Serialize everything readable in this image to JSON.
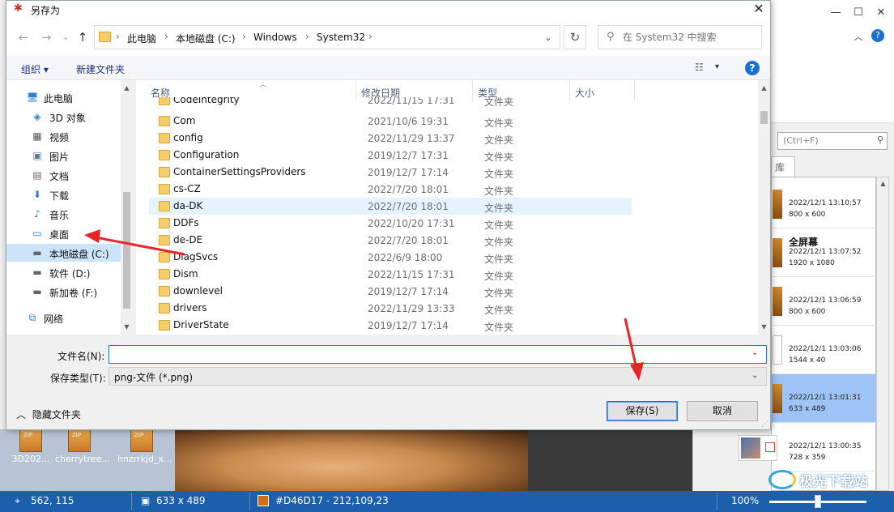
{
  "dialog": {
    "title": "另存为",
    "close_label": "✕"
  },
  "nav": {
    "back": "←",
    "forward": "→",
    "recent": "⌄",
    "up": "↑",
    "breadcrumbs": [
      "此电脑",
      "本地磁盘 (C:)",
      "Windows",
      "System32"
    ],
    "refresh": "↻",
    "search_placeholder": "在 System32 中搜索"
  },
  "toolbar": {
    "organize": "组织 ▾",
    "new_folder": "新建文件夹",
    "view": "☷",
    "view_dd": "▾",
    "help": "?"
  },
  "tree": [
    {
      "label": "此电脑",
      "icon": "pc-icon",
      "glyph": "🖥"
    },
    {
      "label": "3D 对象",
      "icon": "cube-icon",
      "glyph": "◈"
    },
    {
      "label": "视频",
      "icon": "video-icon",
      "glyph": "▦"
    },
    {
      "label": "图片",
      "icon": "image-icon",
      "glyph": "▣"
    },
    {
      "label": "文档",
      "icon": "document-icon",
      "glyph": "▤"
    },
    {
      "label": "下载",
      "icon": "download-icon",
      "glyph": "⬇"
    },
    {
      "label": "音乐",
      "icon": "music-icon",
      "glyph": "♪"
    },
    {
      "label": "桌面",
      "icon": "desktop-icon",
      "glyph": "▭"
    },
    {
      "label": "本地磁盘 (C:)",
      "icon": "drive-c-icon",
      "glyph": "▬"
    },
    {
      "label": "软件 (D:)",
      "icon": "drive-d-icon",
      "glyph": "▬"
    },
    {
      "label": "新加卷 (F:)",
      "icon": "drive-f-icon",
      "glyph": "▬"
    },
    {
      "label": "网络",
      "icon": "network-icon",
      "glyph": "⧉"
    }
  ],
  "columns": [
    "名称",
    "修改日期",
    "类型",
    "大小"
  ],
  "files": [
    {
      "name": "CodeIntegrity",
      "date": "2022/11/15 17:31",
      "type": "文件夹"
    },
    {
      "name": "Com",
      "date": "2021/10/6 19:31",
      "type": "文件夹"
    },
    {
      "name": "config",
      "date": "2022/11/29 13:37",
      "type": "文件夹"
    },
    {
      "name": "Configuration",
      "date": "2019/12/7 17:31",
      "type": "文件夹"
    },
    {
      "name": "ContainerSettingsProviders",
      "date": "2019/12/7 17:14",
      "type": "文件夹"
    },
    {
      "name": "cs-CZ",
      "date": "2022/7/20 18:01",
      "type": "文件夹"
    },
    {
      "name": "da-DK",
      "date": "2022/7/20 18:01",
      "type": "文件夹"
    },
    {
      "name": "DDFs",
      "date": "2022/10/20 17:31",
      "type": "文件夹"
    },
    {
      "name": "de-DE",
      "date": "2022/7/20 18:01",
      "type": "文件夹"
    },
    {
      "name": "DiagSvcs",
      "date": "2022/6/9 18:00",
      "type": "文件夹"
    },
    {
      "name": "Dism",
      "date": "2022/11/15 17:31",
      "type": "文件夹"
    },
    {
      "name": "downlevel",
      "date": "2019/12/7 17:14",
      "type": "文件夹"
    },
    {
      "name": "drivers",
      "date": "2022/11/29 13:33",
      "type": "文件夹"
    },
    {
      "name": "DriverState",
      "date": "2019/12/7 17:14",
      "type": "文件夹"
    }
  ],
  "form": {
    "filename_label": "文件名(N):",
    "filename_value": "",
    "filetype_label": "保存类型(T):",
    "filetype_value": "png-文件 (*.png)",
    "hide_folders": "隐藏文件夹",
    "save": "保存(S)",
    "cancel": "取消"
  },
  "background": {
    "search_placeholder": "(Ctrl+F)",
    "tab_label": "库",
    "desktop_icons": [
      "3D202...",
      "cherrytree...",
      "hnzrrkjd_x..."
    ],
    "thumbs": [
      {
        "title": "",
        "date": "2022/12/1 13:10:57",
        "size": "800 x 600"
      },
      {
        "title": "全屏幕",
        "date": "2022/12/1 13:07:52",
        "size": "1920 x 1080"
      },
      {
        "title": "",
        "date": "2022/12/1 13:06:59",
        "size": "800 x 600"
      },
      {
        "title": "",
        "date": "2022/12/1 13:03:06",
        "size": "1544 x 40"
      },
      {
        "title": "",
        "date": "2022/12/1 13:01:31",
        "size": "633 x 489"
      },
      {
        "title": "",
        "date": "2022/12/1 13:00:35",
        "size": "728 x 359"
      }
    ]
  },
  "status": {
    "cursor": "562, 115",
    "image_size": "633 x 489",
    "color": "#D46D17 - 212,109,23",
    "zoom": "100%",
    "zoom_fraction": 0.5
  },
  "watermark": "极光下载站",
  "colors": {
    "accent": "#1c5fad",
    "pixel_color": "#D46D17",
    "arrow": "#e8242a"
  }
}
